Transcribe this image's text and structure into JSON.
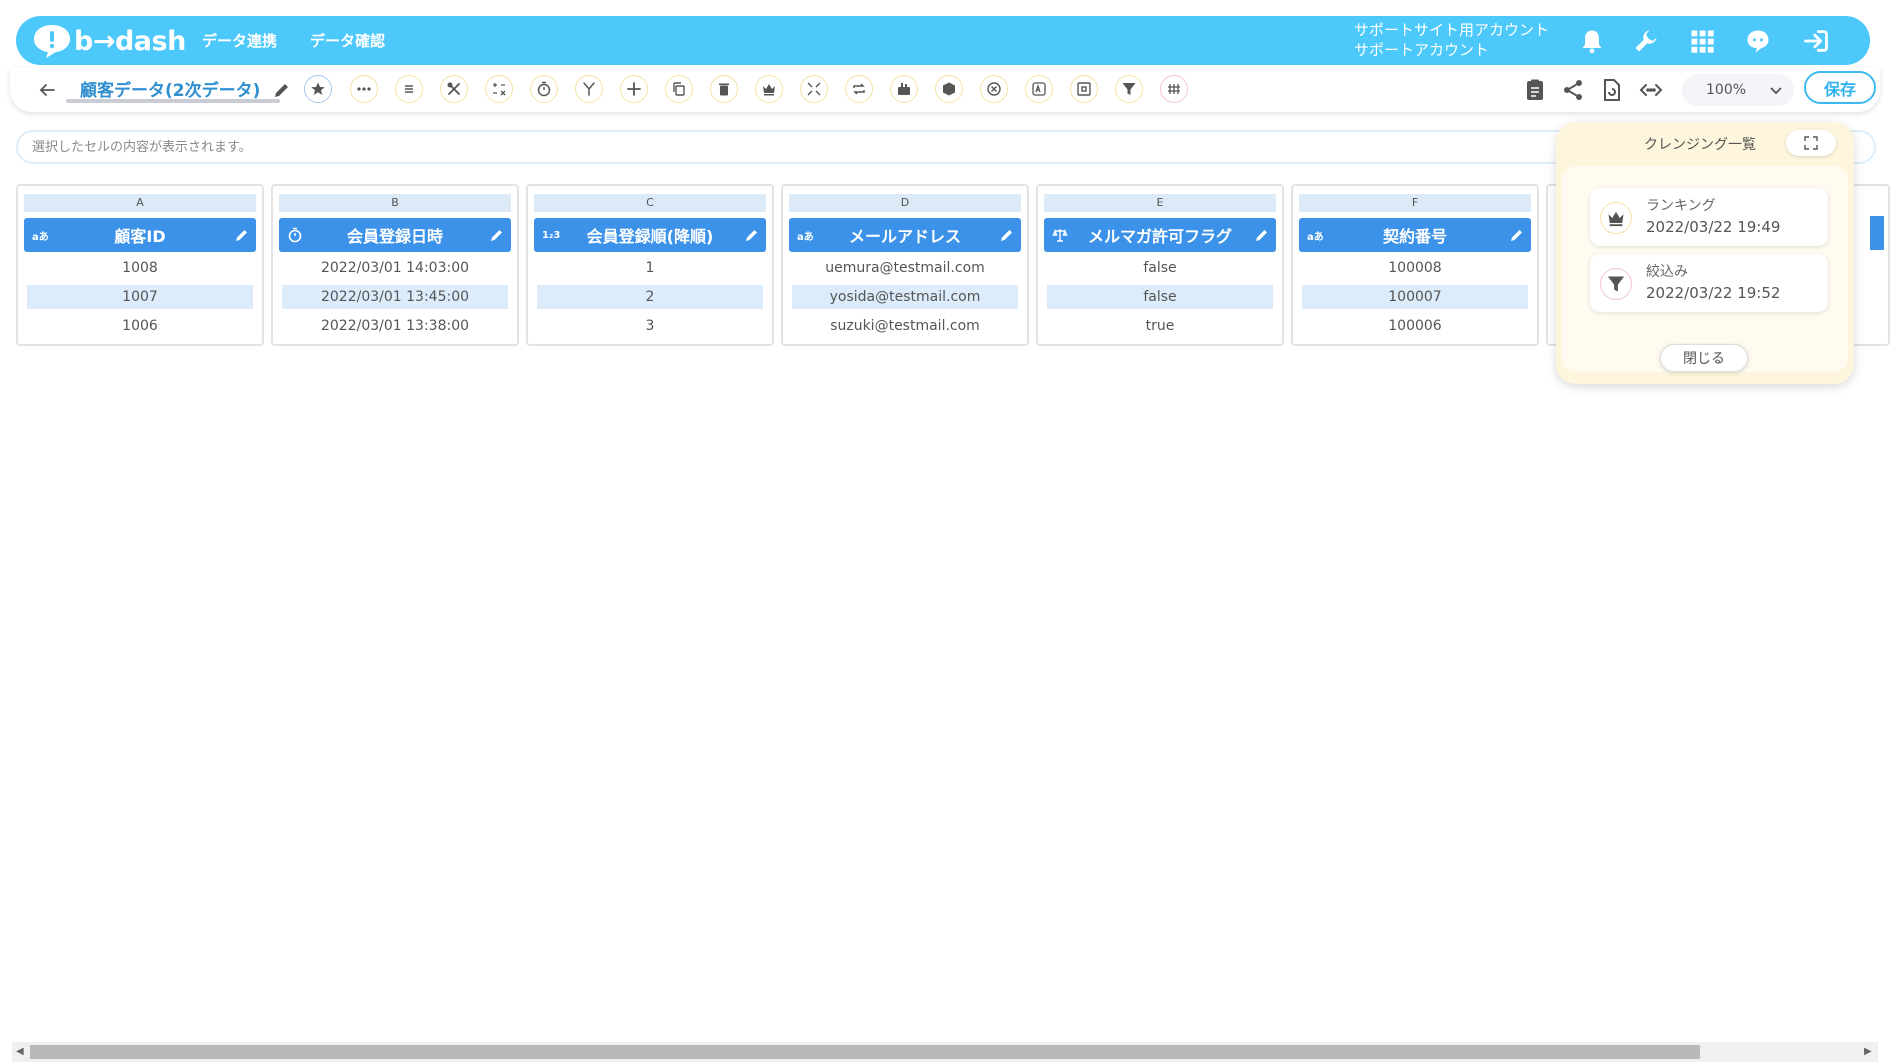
{
  "header": {
    "logo_text": "b→dash",
    "nav": [
      "データ連携",
      "データ確認"
    ],
    "account_line1": "サポートサイト用アカウント",
    "account_line2": "サポートアカウント"
  },
  "toolbar": {
    "title": "顧客データ(2次データ)",
    "zoom": "100%",
    "save_label": "保存"
  },
  "cell_input": {
    "placeholder": "選択したセルの内容が表示されます。"
  },
  "columns": [
    {
      "letter": "A",
      "type": "aあ",
      "title": "顧客ID",
      "cells": [
        "1008",
        "1007",
        "1006"
      ]
    },
    {
      "letter": "B",
      "type": "clock",
      "title": "会員登録日時",
      "cells": [
        "2022/03/01 14:03:00",
        "2022/03/01 13:45:00",
        "2022/03/01 13:38:00"
      ]
    },
    {
      "letter": "C",
      "type": "1₂3",
      "title": "会員登録順(降順)",
      "cells": [
        "1",
        "2",
        "3"
      ]
    },
    {
      "letter": "D",
      "type": "aあ",
      "title": "メールアドレス",
      "cells": [
        "uemura@testmail.com",
        "yosida@testmail.com",
        "suzuki@testmail.com"
      ]
    },
    {
      "letter": "E",
      "type": "scale",
      "title": "メルマガ許可フラグ",
      "cells": [
        "false",
        "false",
        "true"
      ]
    },
    {
      "letter": "F",
      "type": "aあ",
      "title": "契約番号",
      "cells": [
        "100008",
        "100007",
        "100006"
      ]
    }
  ],
  "panel": {
    "title": "クレンジング一覧",
    "items": [
      {
        "name": "ランキング",
        "time": "2022/03/22 19:49",
        "icon": "crown-icon"
      },
      {
        "name": "絞込み",
        "time": "2022/03/22 19:52",
        "icon": "filter-icon"
      }
    ],
    "close_label": "閉じる"
  },
  "colors": {
    "header_bg": "#4dc8fb",
    "column_header": "#3b92e8",
    "row_alt": "#dcecfb",
    "panel_bg": "#fdf6dc",
    "save_border": "#3bb9f0"
  }
}
